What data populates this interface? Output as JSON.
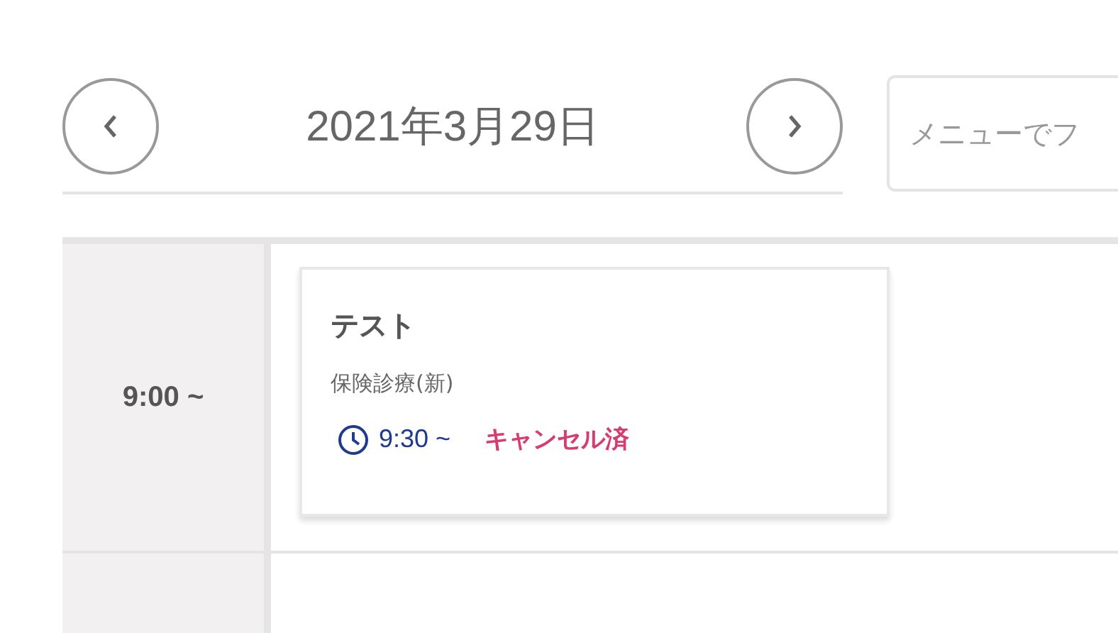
{
  "date_nav": {
    "date": "2021年3月29日"
  },
  "search": {
    "placeholder": "メニューでフ"
  },
  "schedule": {
    "rows": [
      {
        "time": "9:00 ~",
        "appointments": [
          {
            "title": "テスト",
            "menu": "保険診療(新)",
            "time": "9:30 ~",
            "status": {
              "kind": "cancelled",
              "text": "キャンセル済"
            }
          }
        ]
      }
    ]
  }
}
